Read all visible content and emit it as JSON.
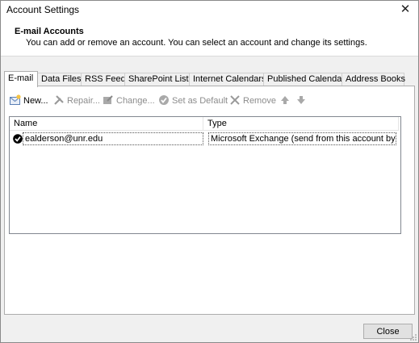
{
  "window": {
    "title": "Account Settings"
  },
  "header": {
    "title": "E-mail Accounts",
    "description": "You can add or remove an account. You can select an account and change its settings."
  },
  "tabs": [
    {
      "label": "E-mail",
      "active": true
    },
    {
      "label": "Data Files"
    },
    {
      "label": "RSS Feeds"
    },
    {
      "label": "SharePoint Lists"
    },
    {
      "label": "Internet Calendars"
    },
    {
      "label": "Published Calendars"
    },
    {
      "label": "Address Books"
    }
  ],
  "toolbar": {
    "new_label": "New...",
    "repair_label": "Repair...",
    "change_label": "Change...",
    "default_label": "Set as Default",
    "remove_label": "Remove"
  },
  "accounts_table": {
    "columns": [
      "Name",
      "Type"
    ],
    "rows": [
      {
        "name": "ealderson@unr.edu",
        "type": "Microsoft Exchange (send from this account by def..."
      }
    ]
  },
  "footer": {
    "close_label": "Close"
  }
}
